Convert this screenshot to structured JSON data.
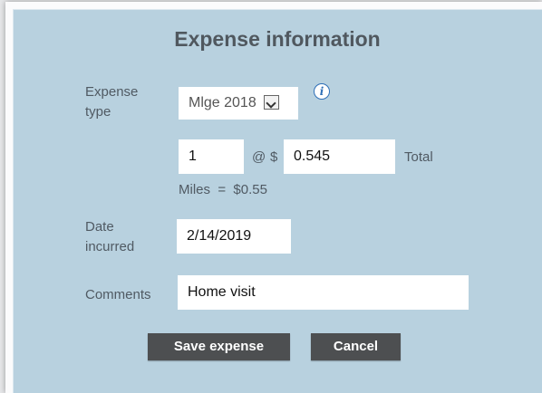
{
  "title": "Expense information",
  "labels": {
    "expense_type": "Expense type",
    "date_incurred": "Date incurred",
    "comments": "Comments"
  },
  "expense_type": {
    "selected": "Mlge 2018"
  },
  "info_icon": "i",
  "quantity": "1",
  "at_symbol": "@",
  "currency_symbol": "$",
  "rate": "0.545",
  "total_label": "Total",
  "miles_summary": "Miles  =  $0.55",
  "date_incurred": "2/14/2019",
  "comments": "Home visit",
  "buttons": {
    "save": "Save expense",
    "cancel": "Cancel"
  },
  "colors": {
    "panel": "#b8d1df",
    "button": "#4d4f51",
    "title": "#50585f"
  }
}
